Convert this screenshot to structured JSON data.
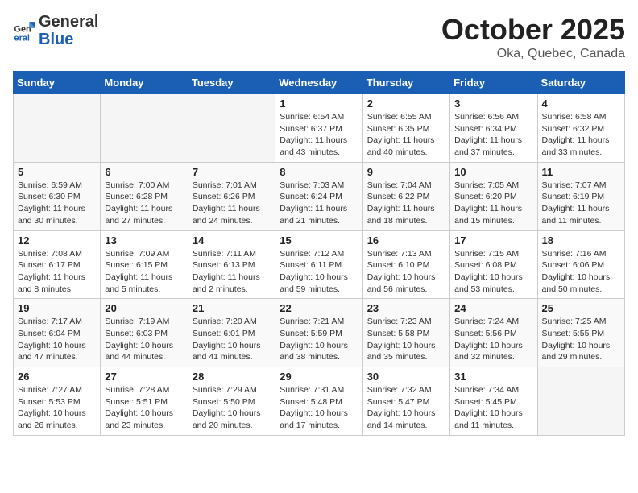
{
  "header": {
    "logo_line1": "General",
    "logo_line2": "Blue",
    "month": "October 2025",
    "location": "Oka, Quebec, Canada"
  },
  "weekdays": [
    "Sunday",
    "Monday",
    "Tuesday",
    "Wednesday",
    "Thursday",
    "Friday",
    "Saturday"
  ],
  "weeks": [
    [
      {
        "day": "",
        "info": ""
      },
      {
        "day": "",
        "info": ""
      },
      {
        "day": "",
        "info": ""
      },
      {
        "day": "1",
        "info": "Sunrise: 6:54 AM\nSunset: 6:37 PM\nDaylight: 11 hours\nand 43 minutes."
      },
      {
        "day": "2",
        "info": "Sunrise: 6:55 AM\nSunset: 6:35 PM\nDaylight: 11 hours\nand 40 minutes."
      },
      {
        "day": "3",
        "info": "Sunrise: 6:56 AM\nSunset: 6:34 PM\nDaylight: 11 hours\nand 37 minutes."
      },
      {
        "day": "4",
        "info": "Sunrise: 6:58 AM\nSunset: 6:32 PM\nDaylight: 11 hours\nand 33 minutes."
      }
    ],
    [
      {
        "day": "5",
        "info": "Sunrise: 6:59 AM\nSunset: 6:30 PM\nDaylight: 11 hours\nand 30 minutes."
      },
      {
        "day": "6",
        "info": "Sunrise: 7:00 AM\nSunset: 6:28 PM\nDaylight: 11 hours\nand 27 minutes."
      },
      {
        "day": "7",
        "info": "Sunrise: 7:01 AM\nSunset: 6:26 PM\nDaylight: 11 hours\nand 24 minutes."
      },
      {
        "day": "8",
        "info": "Sunrise: 7:03 AM\nSunset: 6:24 PM\nDaylight: 11 hours\nand 21 minutes."
      },
      {
        "day": "9",
        "info": "Sunrise: 7:04 AM\nSunset: 6:22 PM\nDaylight: 11 hours\nand 18 minutes."
      },
      {
        "day": "10",
        "info": "Sunrise: 7:05 AM\nSunset: 6:20 PM\nDaylight: 11 hours\nand 15 minutes."
      },
      {
        "day": "11",
        "info": "Sunrise: 7:07 AM\nSunset: 6:19 PM\nDaylight: 11 hours\nand 11 minutes."
      }
    ],
    [
      {
        "day": "12",
        "info": "Sunrise: 7:08 AM\nSunset: 6:17 PM\nDaylight: 11 hours\nand 8 minutes."
      },
      {
        "day": "13",
        "info": "Sunrise: 7:09 AM\nSunset: 6:15 PM\nDaylight: 11 hours\nand 5 minutes."
      },
      {
        "day": "14",
        "info": "Sunrise: 7:11 AM\nSunset: 6:13 PM\nDaylight: 11 hours\nand 2 minutes."
      },
      {
        "day": "15",
        "info": "Sunrise: 7:12 AM\nSunset: 6:11 PM\nDaylight: 10 hours\nand 59 minutes."
      },
      {
        "day": "16",
        "info": "Sunrise: 7:13 AM\nSunset: 6:10 PM\nDaylight: 10 hours\nand 56 minutes."
      },
      {
        "day": "17",
        "info": "Sunrise: 7:15 AM\nSunset: 6:08 PM\nDaylight: 10 hours\nand 53 minutes."
      },
      {
        "day": "18",
        "info": "Sunrise: 7:16 AM\nSunset: 6:06 PM\nDaylight: 10 hours\nand 50 minutes."
      }
    ],
    [
      {
        "day": "19",
        "info": "Sunrise: 7:17 AM\nSunset: 6:04 PM\nDaylight: 10 hours\nand 47 minutes."
      },
      {
        "day": "20",
        "info": "Sunrise: 7:19 AM\nSunset: 6:03 PM\nDaylight: 10 hours\nand 44 minutes."
      },
      {
        "day": "21",
        "info": "Sunrise: 7:20 AM\nSunset: 6:01 PM\nDaylight: 10 hours\nand 41 minutes."
      },
      {
        "day": "22",
        "info": "Sunrise: 7:21 AM\nSunset: 5:59 PM\nDaylight: 10 hours\nand 38 minutes."
      },
      {
        "day": "23",
        "info": "Sunrise: 7:23 AM\nSunset: 5:58 PM\nDaylight: 10 hours\nand 35 minutes."
      },
      {
        "day": "24",
        "info": "Sunrise: 7:24 AM\nSunset: 5:56 PM\nDaylight: 10 hours\nand 32 minutes."
      },
      {
        "day": "25",
        "info": "Sunrise: 7:25 AM\nSunset: 5:55 PM\nDaylight: 10 hours\nand 29 minutes."
      }
    ],
    [
      {
        "day": "26",
        "info": "Sunrise: 7:27 AM\nSunset: 5:53 PM\nDaylight: 10 hours\nand 26 minutes."
      },
      {
        "day": "27",
        "info": "Sunrise: 7:28 AM\nSunset: 5:51 PM\nDaylight: 10 hours\nand 23 minutes."
      },
      {
        "day": "28",
        "info": "Sunrise: 7:29 AM\nSunset: 5:50 PM\nDaylight: 10 hours\nand 20 minutes."
      },
      {
        "day": "29",
        "info": "Sunrise: 7:31 AM\nSunset: 5:48 PM\nDaylight: 10 hours\nand 17 minutes."
      },
      {
        "day": "30",
        "info": "Sunrise: 7:32 AM\nSunset: 5:47 PM\nDaylight: 10 hours\nand 14 minutes."
      },
      {
        "day": "31",
        "info": "Sunrise: 7:34 AM\nSunset: 5:45 PM\nDaylight: 10 hours\nand 11 minutes."
      },
      {
        "day": "",
        "info": ""
      }
    ]
  ]
}
